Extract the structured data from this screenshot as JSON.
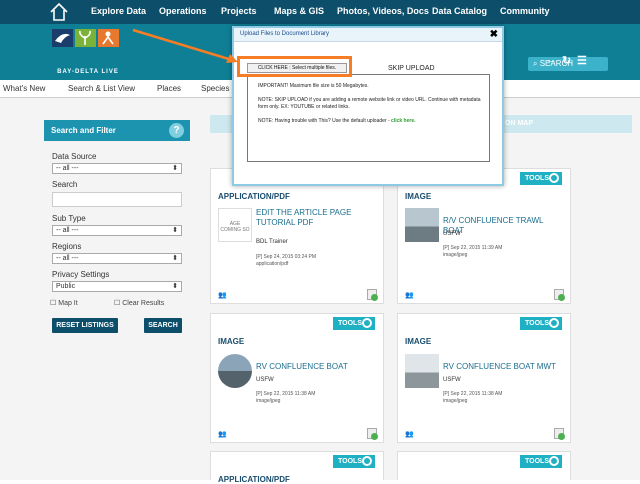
{
  "topnav": {
    "items": [
      "Explore Data",
      "Operations",
      "Projects",
      "Maps & GIS",
      "Photos, Videos, Docs",
      "Data Catalog",
      "Community"
    ]
  },
  "header": {
    "logo_text": "BAY-DELTA LIVE",
    "search_label": "SEARCH"
  },
  "subnav": {
    "items": [
      "What's New",
      "Search & List View",
      "Places",
      "Species &"
    ]
  },
  "sidebar": {
    "title": "Search and Filter",
    "help": "?",
    "data_source_label": "Data Source",
    "data_source_value": "-- all ---",
    "search_label": "Search",
    "search_value": "",
    "subtype_label": "Sub Type",
    "subtype_value": "-- all ---",
    "regions_label": "Regions",
    "regions_value": "-- all ---",
    "privacy_label": "Privacy Settings",
    "privacy_value": "Public",
    "map_it_label": "Map It",
    "clear_results_label": "Clear Results",
    "reset_label": "RESET LISTINGS",
    "search_button": "SEARCH"
  },
  "results": {
    "map_tab": "ON MAP",
    "tools_label": "TOOLS",
    "cards": [
      {
        "type": "APPLICATION/PDF",
        "title": "EDIT THE ARTICLE PAGE TUTORIAL PDF",
        "user": "BDL Trainer",
        "date": "[P] Sep 24, 2015 03:24 PM",
        "mime": "application/pdf",
        "thumb_text": "AGE COMING SO"
      },
      {
        "type": "IMAGE",
        "title": "R/V CONFLUENCE TRAWL BOAT",
        "user": "USFW",
        "date": "[P] Sep 22, 2015 11:39 AM",
        "mime": "image/jpeg"
      },
      {
        "type": "IMAGE",
        "title": "RV CONFLUENCE BOAT",
        "user": "USFW",
        "date": "[P] Sep 22, 2015 11:38 AM",
        "mime": "image/jpeg"
      },
      {
        "type": "IMAGE",
        "title": "RV CONFLUENCE BOAT MWT",
        "user": "USFW",
        "date": "[P] Sep 22, 2015 11:38 AM",
        "mime": "image/jpeg"
      },
      {
        "type": "APPLICATION/PDF"
      }
    ]
  },
  "dialog": {
    "title": "Upload Files to Document Library",
    "close": "✖",
    "select_files": "CLICK HERE : Select multiple files.",
    "skip_upload": "SKIP UPLOAD",
    "line1": "IMPORTANT! Maximum file size is 50 Megabytes.",
    "line2": "NOTE: SKIP UPLOAD if you are adding a remote website link or video URL. Continue with metadata form only. EX: YOUTUBE or related links.",
    "line3": "NOTE: Having trouble with This? Use the default uploader - ",
    "line3_link": "click here."
  },
  "colors": {
    "nav": "#0d4f6b",
    "header": "#0f7f96",
    "accent": "#1fb0c4",
    "highlight": "#f47d25"
  }
}
